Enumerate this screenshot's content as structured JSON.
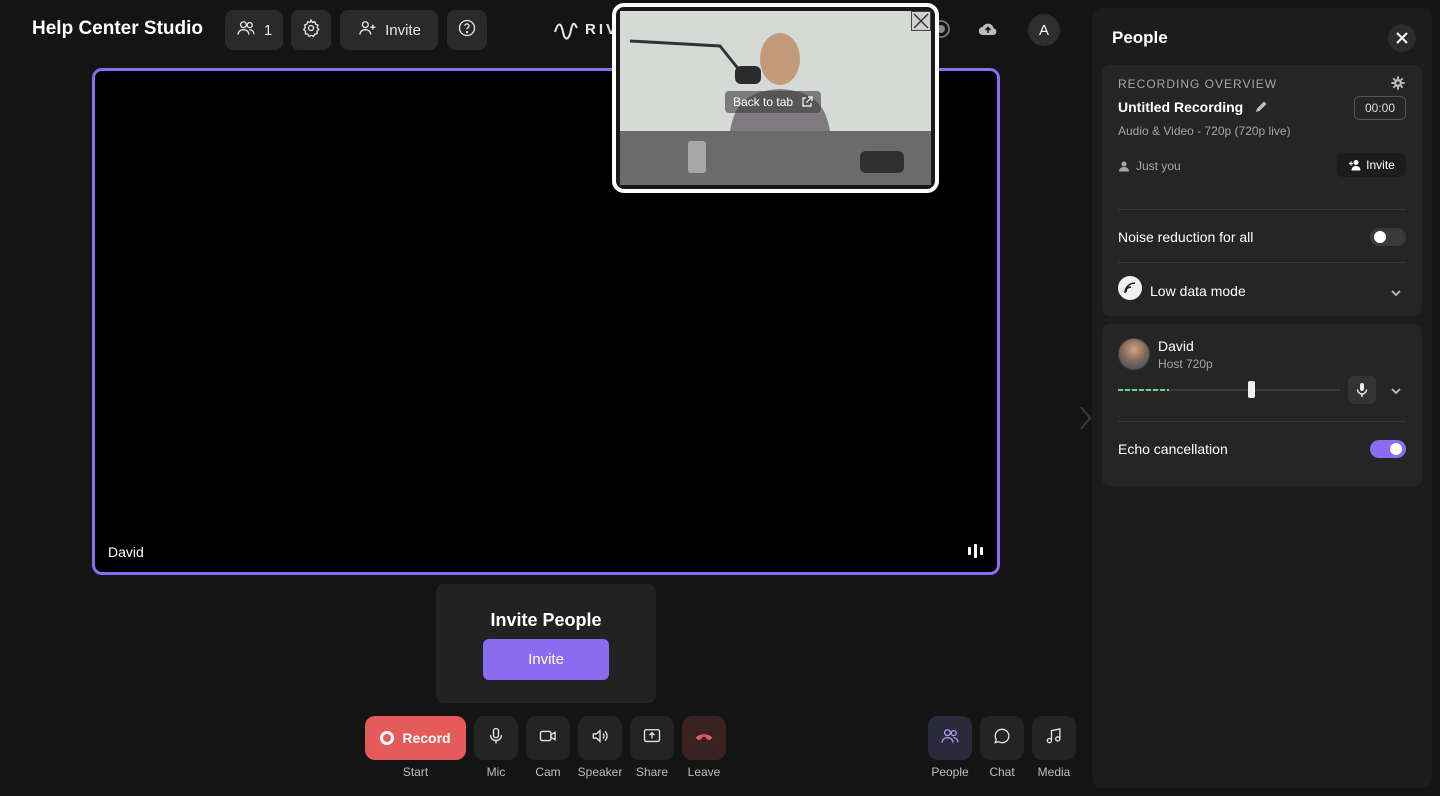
{
  "header": {
    "title": "Help Center Studio",
    "participants_count": "1",
    "invite_label": "Invite",
    "logo_text": "RIVE",
    "avatar_initial": "A"
  },
  "stage": {
    "participant_name": "David"
  },
  "pip": {
    "back_label": "Back to tab"
  },
  "invite_card": {
    "title": "Invite People",
    "button_label": "Invite"
  },
  "controls": {
    "record_label": "Record",
    "start_label": "Start",
    "mic_label": "Mic",
    "cam_label": "Cam",
    "speaker_label": "Speaker",
    "share_label": "Share",
    "leave_label": "Leave",
    "people_label": "People",
    "chat_label": "Chat",
    "media_label": "Media"
  },
  "panel": {
    "title": "People",
    "recording": {
      "overline": "RECORDING OVERVIEW",
      "title": "Untitled Recording",
      "timer": "00:00",
      "meta": "Audio & Video - 720p (720p live)",
      "who": "Just you",
      "invite_label": "Invite"
    },
    "noise_reduction": {
      "label": "Noise reduction for all",
      "enabled": false
    },
    "low_data_mode": {
      "label": "Low data mode"
    },
    "person": {
      "name": "David",
      "role": "Host  720p",
      "volume_level": 0.23,
      "volume_handle": 0.6
    },
    "echo_cancellation": {
      "label": "Echo cancellation",
      "enabled": true
    }
  },
  "colors": {
    "accent": "#8b6cf0",
    "record": "#e55b5b",
    "background": "#141414",
    "panel": "#1c1c1c"
  },
  "icons": [
    "people-icon",
    "gear-icon",
    "add-user-icon",
    "help-icon",
    "cloud-upload-icon",
    "mic-icon",
    "camera-icon",
    "speaker-icon",
    "share-screen-icon",
    "phone-hangup-icon",
    "chat-icon",
    "music-note-icon",
    "pencil-icon",
    "user-icon",
    "chevron-down-icon",
    "close-icon"
  ]
}
